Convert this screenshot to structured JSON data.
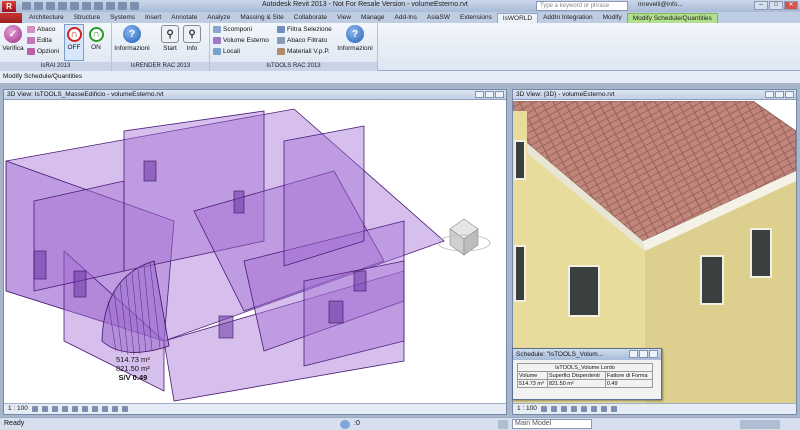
{
  "app": {
    "title": "Autodesk Revit 2013 -   Not For Resale Version -   volumeEsterno.rvt",
    "logo": "R",
    "search_placeholder": "Type a keyword or phrase",
    "user": "mrevelli@info..."
  },
  "tabs": [
    {
      "label": "Architecture"
    },
    {
      "label": "Structure"
    },
    {
      "label": "Systems"
    },
    {
      "label": "Insert"
    },
    {
      "label": "Annotate"
    },
    {
      "label": "Analyze"
    },
    {
      "label": "Massing & Site"
    },
    {
      "label": "Collaborate"
    },
    {
      "label": "View"
    },
    {
      "label": "Manage"
    },
    {
      "label": "Add-Ins"
    },
    {
      "label": "AsiaSW"
    },
    {
      "label": "Extensions"
    },
    {
      "label": "IsWORLD"
    },
    {
      "label": "AddIn Integration"
    },
    {
      "label": "Modify"
    },
    {
      "label": "Modify Schedule/Quantities"
    }
  ],
  "ribbon": {
    "israi": {
      "label": "IsRAI 2013",
      "verifica": "Verifica",
      "abaco": "Abaco",
      "edita": "Edita",
      "opzioni": "Opzioni",
      "off": "OFF",
      "on": "ON"
    },
    "isrender": {
      "label": "IsRENDER RAC 2013",
      "informazioni": "Informazioni",
      "start": "Start",
      "info": "Info"
    },
    "istools": {
      "label": "IsTOOLS RAC 2013",
      "scomponi": "Scomponi",
      "volume_esterno": "Volume Esterno",
      "locali": "Locali",
      "filtra": "Filtra Selezione",
      "abaco_filtrato": "Abaco Filtrato",
      "materiali": "Materiali V.p.P.",
      "informazioni": "Informazioni"
    }
  },
  "options_bar": "Modify Schedule/Quantities",
  "view_left": {
    "title": "3D View: IsTOOLS_MasseEdificio - volumeEsterno.rvt",
    "scale": "1 : 100",
    "value1": "514.73 m³",
    "value2": "821.50 m²",
    "ratio": "S/V 0.49"
  },
  "view_right": {
    "title": "3D View: {3D} - volumeEsterno.rvt",
    "scale": "1 : 100"
  },
  "schedule": {
    "title": "Schedule: \"IsTOOLS_Volum...",
    "header": "IsTOOLS_Volume Lordo",
    "cols": [
      "Volume",
      "Superfici Disperdenti",
      "Fattore di Forma"
    ],
    "row": [
      "514.73 m³",
      "821.50 m²",
      "0.49"
    ]
  },
  "status": {
    "left": "Ready",
    "coords": ":0",
    "model": "Main Model"
  },
  "colors": {
    "mass_fill": "#a572d4",
    "mass_stroke": "#4a1b78",
    "wall_yellow": "#e8dc9c",
    "roof_red": "#c0857b"
  }
}
